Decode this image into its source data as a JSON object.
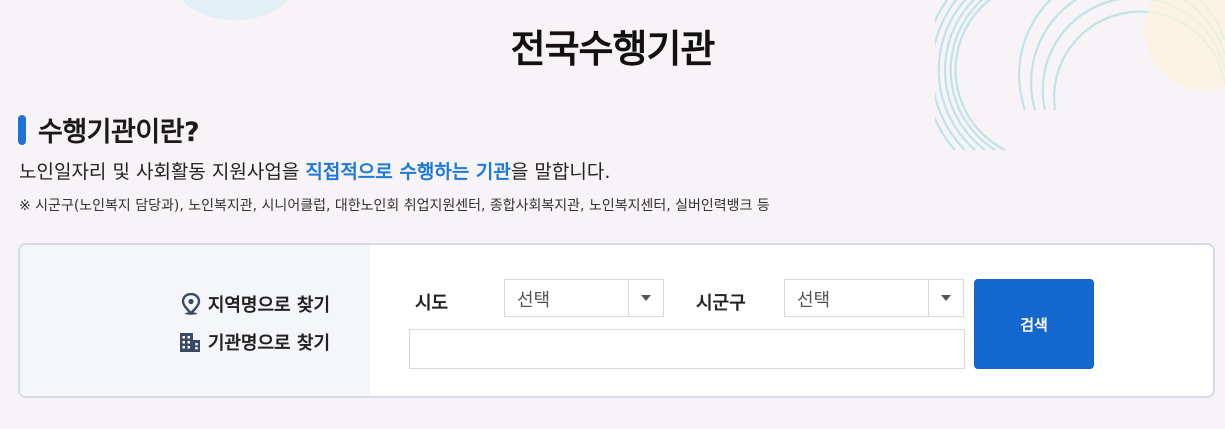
{
  "page": {
    "title": "전국수행기관"
  },
  "section": {
    "heading": "수행기관이란?",
    "description_prefix": "노인일자리 및 사회활동 지원사업을 ",
    "description_highlight": "직접적으로 수행하는 기관",
    "description_suffix": "을 말합니다.",
    "note": "※ 시군구(노인복지 담당과), 노인복지관, 시니어클럽, 대한노인회 취업지원센터, 종합사회복지관, 노인복지센터, 실버인력뱅크 등"
  },
  "search": {
    "modes": [
      {
        "label": "지역명으로 찾기",
        "icon": "location-pin-icon"
      },
      {
        "label": "기관명으로 찾기",
        "icon": "building-icon"
      }
    ],
    "sido_label": "시도",
    "sido_value": "선택",
    "sigungu_label": "시군구",
    "sigungu_value": "선택",
    "keyword_value": "",
    "button_label": "검색"
  },
  "colors": {
    "accent": "#1d74d6",
    "highlight_text": "#1e7ad8",
    "button": "#1467cc",
    "background": "#f8f3f7",
    "panel_left": "#f4f6f9",
    "panel_border": "#d3dbe7"
  }
}
